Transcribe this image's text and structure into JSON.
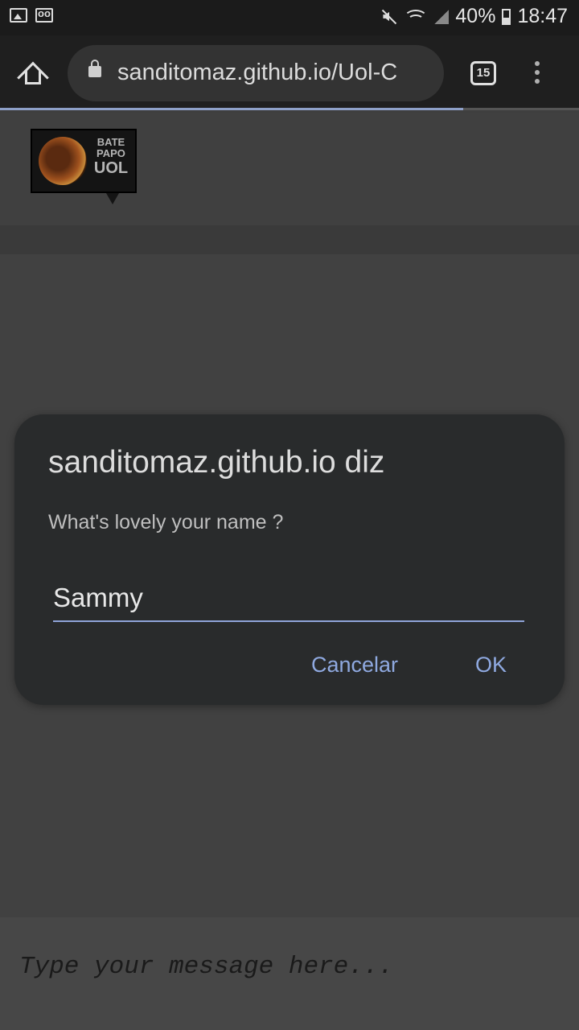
{
  "status_bar": {
    "battery": "40%",
    "time": "18:47",
    "icons": [
      "image-icon",
      "voicemail-icon",
      "mute-icon",
      "wifi-icon",
      "signal-icon",
      "battery-icon"
    ]
  },
  "browser": {
    "url": "sanditomaz.github.io/Uol-C",
    "tab_count": "15",
    "load_progress": 0.8
  },
  "logo": {
    "line1": "BATE",
    "line2": "PAPO",
    "line3": "UOL"
  },
  "dialog": {
    "title": "sanditomaz.github.io diz",
    "message": "What's lovely your name ?",
    "input_value": "Sammy",
    "cancel_label": "Cancelar",
    "ok_label": "OK"
  },
  "composer": {
    "placeholder": "Type your message here..."
  },
  "colors": {
    "accent": "#8fa9e0",
    "dialog_bg": "#292b2c",
    "page_bg": "#414141"
  }
}
